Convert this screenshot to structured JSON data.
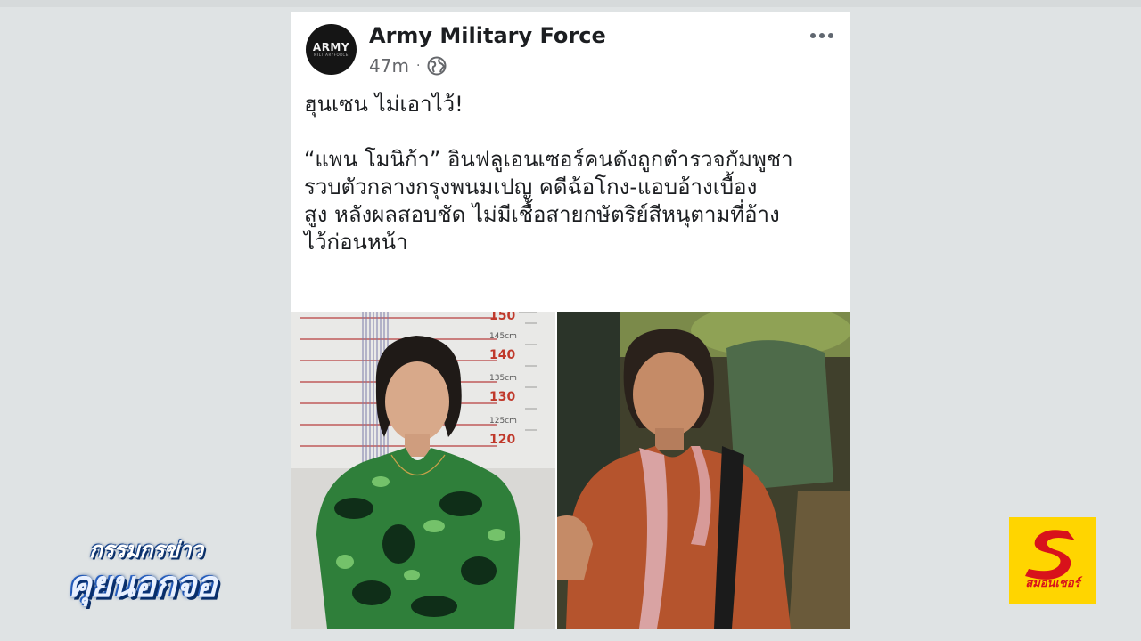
{
  "post": {
    "page_name": "Army Military Force",
    "avatar_logo": "ARMY",
    "avatar_logo_sub": "MILITARYFORCE",
    "time": "47m",
    "separator": "·",
    "audience_icon": "globe-icon",
    "more_icon": "more-options-icon",
    "text_line1": "ฮุนเซน ไม่เอาไว้!",
    "text_body": "“แพน โมนิก้า” อินฟลูเอนเซอร์คนดังถูกตำรวจกัมพูชา\nรวบตัวกลางกรุงพนมเปญ คดีฉ้อโกง-แอบอ้างเบื้อง\nสูง หลังผลสอบชัด ไม่มีเชื้อสายกษัตริย์สีหนุตามที่อ้าง\nไว้ก่อนหน้า",
    "height_chart_labels": [
      "150",
      "145cm",
      "140",
      "135cm",
      "130",
      "125cm",
      "120"
    ]
  },
  "overlay": {
    "show_title_line1": "กรรมกรข่าว",
    "show_title_line2": "คุยนอกจอ",
    "channel_name": "สมอนเชอร์"
  },
  "colors": {
    "background": "#dfe3e4",
    "card": "#ffffff",
    "text": "#1c1e21",
    "meta": "#65676b",
    "channel_yellow": "#ffd500",
    "channel_red": "#d8121b"
  }
}
